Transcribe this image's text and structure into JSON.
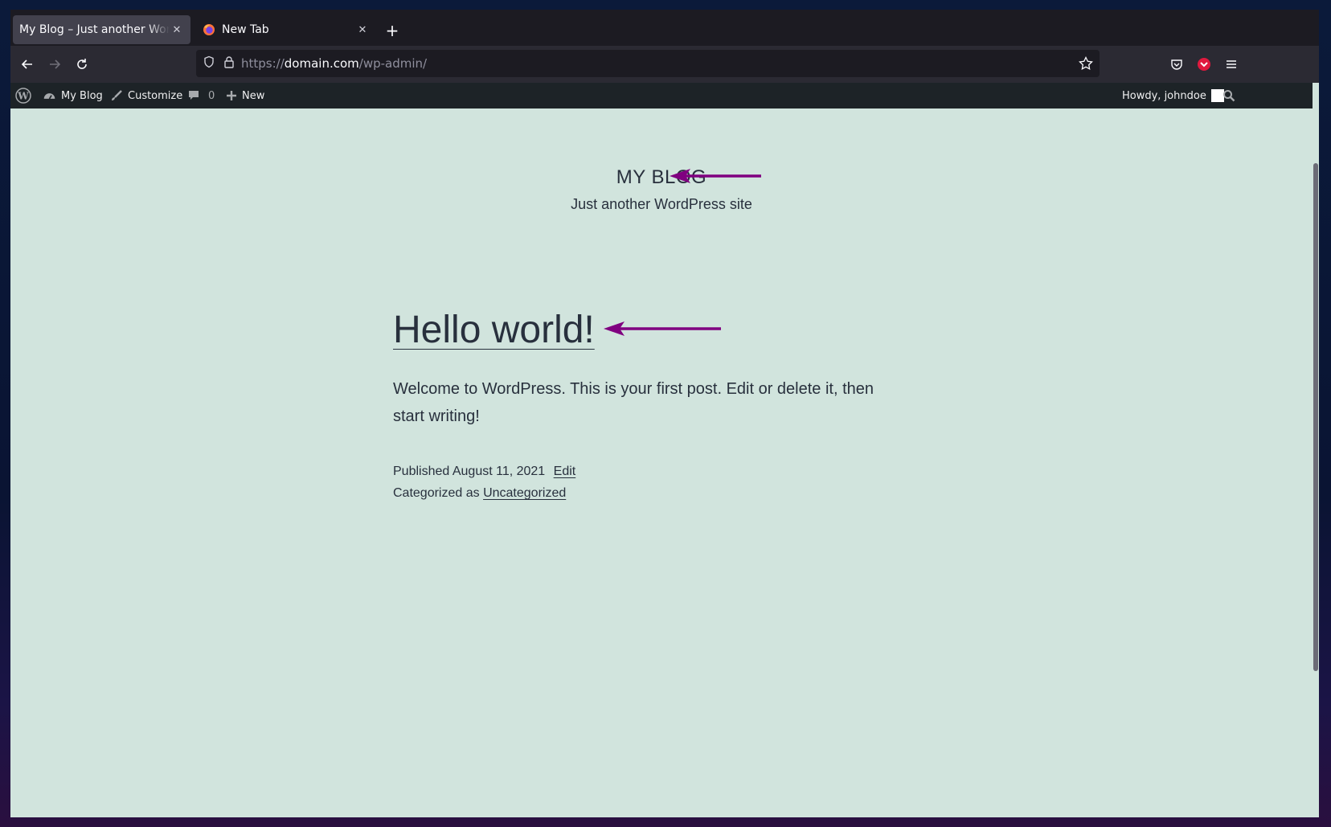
{
  "browser": {
    "tabs": [
      {
        "title": "My Blog – Just another WordPress site",
        "active": true
      },
      {
        "title": "New Tab",
        "active": false
      }
    ],
    "url": {
      "scheme": "https://",
      "host": "domain.com",
      "path": "/wp-admin/"
    }
  },
  "adminbar": {
    "site_name": "My Blog",
    "customize": "Customize",
    "comments_count": "0",
    "new_label": "New",
    "howdy": "Howdy, johndoe"
  },
  "site": {
    "title": "MY BLOG",
    "description": "Just another WordPress site"
  },
  "post": {
    "title": "Hello world!",
    "body": "Welcome to WordPress. This is your first post. Edit or delete it, then start writing!",
    "published_label": "Published",
    "date": "August 11, 2021",
    "edit_label": "Edit",
    "categorized_label": "Categorized as",
    "category": "Uncategorized"
  },
  "colors": {
    "annotation_arrow": "#800080",
    "page_background": "#d1e4dd",
    "adminbar_background": "#1d2327"
  }
}
